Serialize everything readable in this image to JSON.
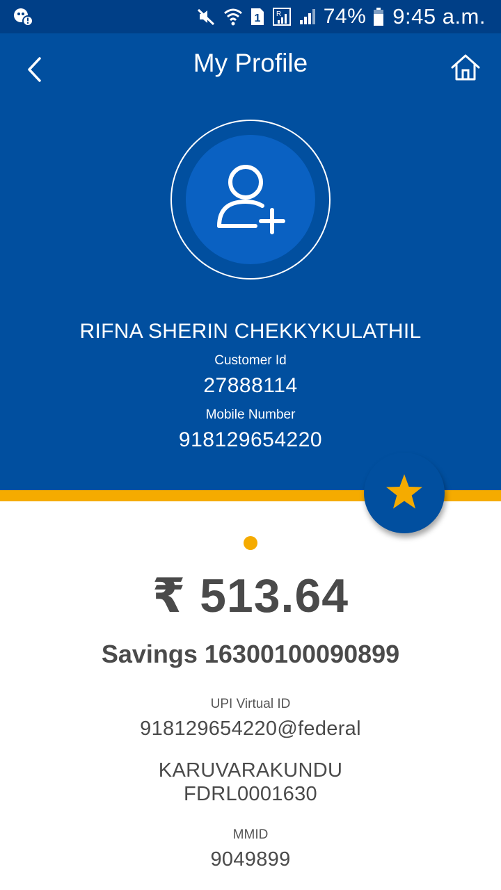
{
  "status_bar": {
    "battery_percent": "74%",
    "time": "9:45 a.m.",
    "sim_label": "1",
    "icons": [
      "notification-icon",
      "mute-icon",
      "wifi-icon",
      "sim-icon",
      "roaming-signal-icon",
      "signal-icon",
      "battery-icon"
    ]
  },
  "header": {
    "title": "My Profile",
    "back_icon": "chevron-left-icon",
    "home_icon": "home-icon",
    "avatar_icon": "add-user-icon"
  },
  "profile": {
    "name": "RIFNA SHERIN CHEKKYKULATHIL",
    "customer_id_label": "Customer Id",
    "customer_id": "27888114",
    "mobile_label": "Mobile Number",
    "mobile": "918129654220"
  },
  "account": {
    "balance": "₹ 513.64",
    "account_line": "Savings 16300100090899",
    "upi_label": "UPI Virtual ID",
    "upi_id": "918129654220@federal",
    "branch": "KARUVARAKUNDU",
    "ifsc": "FDRL0001630",
    "mmid_label": "MMID",
    "mmid": "9049899"
  },
  "colors": {
    "status_bar": "#003f87",
    "header_bg": "#014f9f",
    "avatar_bg": "#0a61c2",
    "accent": "#f5ab00",
    "text_dark": "#4a4a4a"
  }
}
